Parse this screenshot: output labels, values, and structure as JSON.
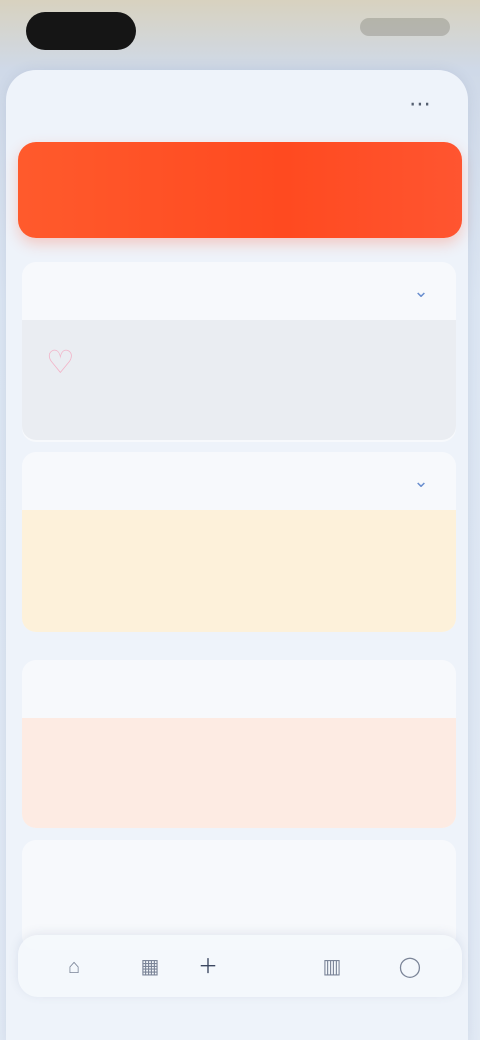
{
  "status_bar": {},
  "nav": {
    "title": "",
    "action_icon": "ellipsis-icon"
  },
  "banner": {
    "left_text": "",
    "right_text": ""
  },
  "sections": {
    "tracker": {
      "title": "",
      "icon": "heart-icon",
      "line1": "",
      "line2": ""
    },
    "tip": {
      "title": "",
      "text": ""
    },
    "stats": {
      "title": "",
      "label": "",
      "sub": "",
      "caption": "",
      "value": ""
    },
    "list": {
      "title": "",
      "left": "",
      "right": ""
    }
  },
  "tabbar": {
    "items": [
      {
        "icon": "home-icon"
      },
      {
        "icon": "calendar-icon"
      },
      {
        "icon": "plus-icon"
      },
      {
        "icon": "chart-icon"
      },
      {
        "icon": "profile-icon"
      }
    ]
  },
  "colors": {
    "accent": "#ff4a20",
    "tip_bg": "#fdf1da",
    "stat_bg": "#fdebe3"
  }
}
